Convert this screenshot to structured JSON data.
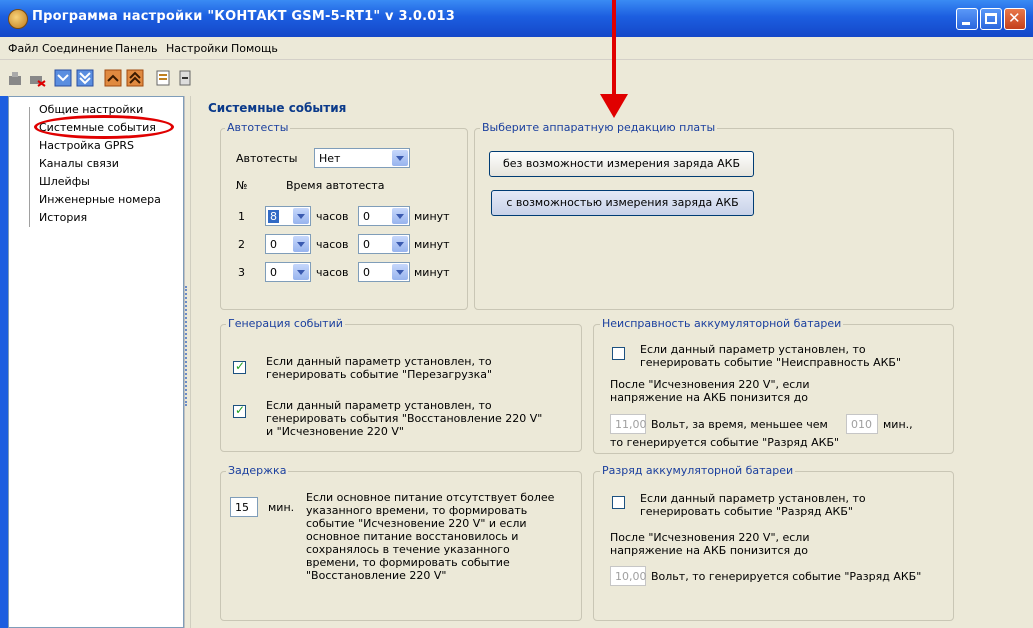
{
  "window": {
    "title": "Программа настройки \"КОНТАКТ GSM-5-RT1\" v 3.0.013"
  },
  "menu": [
    "Файл",
    "Соединение",
    "Панель",
    "Настройки",
    "Помощь"
  ],
  "toolbar_icons": [
    "connect-icon",
    "disconnect-icon",
    "read-icon",
    "read-all-icon",
    "write-icon",
    "write-all-icon",
    "open-file-icon",
    "save-file-icon"
  ],
  "tree": {
    "items": [
      "Общие настройки",
      "Системные события",
      "Настройка GPRS",
      "Каналы связи",
      "Шлейфы",
      "Инженерные номера",
      "История"
    ],
    "selected": "Системные события"
  },
  "main": {
    "title": "Системные события",
    "autotests": {
      "legend": "Автотесты",
      "label": "Автотесты",
      "value": "Нет",
      "col_no": "№",
      "col_time": "Время автотеста",
      "hours_label": "часов",
      "minutes_label": "минут",
      "rows": [
        {
          "n": "1",
          "hours": "8",
          "minutes": "0"
        },
        {
          "n": "2",
          "hours": "0",
          "minutes": "0"
        },
        {
          "n": "3",
          "hours": "0",
          "minutes": "0"
        }
      ]
    },
    "hardware": {
      "legend": "Выберите аппаратную редакцию платы",
      "btn_without": "без возможности измерения заряда АКБ",
      "btn_with": "с возможностью измерения заряда АКБ"
    },
    "events": {
      "legend": "Генерация событий",
      "item1": {
        "checked": true,
        "line1": "Если данный параметр установлен, то",
        "line2": "генерировать событие \"Перезагрузка\""
      },
      "item2": {
        "checked": true,
        "line1": "Если данный параметр установлен, то",
        "line2": "генерировать события \"Восстановление 220 V\"",
        "line3": "и \"Исчезновение 220 V\""
      }
    },
    "battery_fault": {
      "legend": "Неисправность аккумуляторной батареи",
      "checked": false,
      "line1": "Если данный параметр установлен, то",
      "line2": "генерировать событие \"Неисправность АКБ\"",
      "text1": "После \"Исчезновения 220 V\", если",
      "text2": "напряжение на АКБ понизится до",
      "volt_value": "11,00",
      "volt_text": "Вольт, за время, меньшее чем",
      "min_value": "010",
      "min_label": "мин.,",
      "text3": "то генерируется событие \"Разряд АКБ\""
    },
    "delay": {
      "legend": "Задержка",
      "value": "15",
      "unit": "мин.",
      "lines": [
        "Если основное питание отсутствует более",
        "указанного времени, то формировать",
        "событие \"Исчезновение 220 V\" и если",
        "основное питание восстановилось и",
        "сохранялось в течение указанного",
        "времени, то формировать событие",
        "\"Восстановление 220 V\""
      ]
    },
    "battery_discharge": {
      "legend": "Разряд аккумуляторной батареи",
      "checked": false,
      "line1": "Если данный параметр установлен, то",
      "line2": "генерировать событие \"Разряд АКБ\"",
      "text1": "После \"Исчезновения 220 V\", если",
      "text2": "напряжение на АКБ понизится до",
      "volt_value": "10,00",
      "volt_text": "Вольт, то генерируется событие \"Разряд АКБ\""
    }
  },
  "colors": {
    "titlebar": "#1c5ee0",
    "panel": "#ece9d8",
    "legend_text": "#1a3f9e",
    "annotation": "#e00000"
  }
}
